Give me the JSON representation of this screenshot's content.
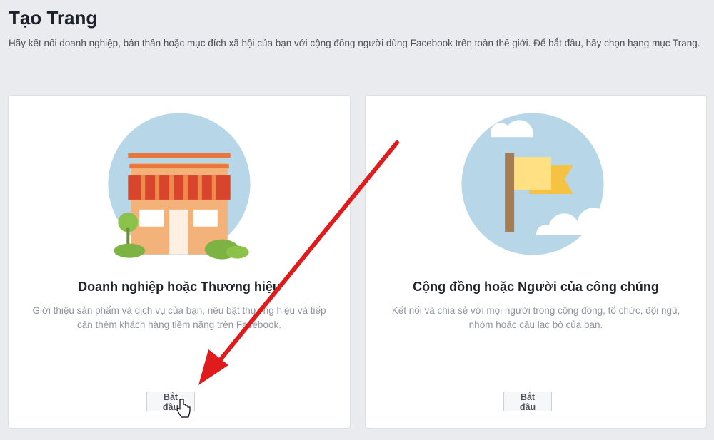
{
  "header": {
    "title": "Tạo Trang",
    "description": "Hãy kết nối doanh nghiệp, bản thân hoặc mục đích xã hội của bạn với cộng đồng người dùng Facebook trên toàn thế giới. Để bắt đầu, hãy chọn hạng mục Trang."
  },
  "cards": [
    {
      "title": "Doanh nghiệp hoặc Thương hiệu",
      "description": "Giới thiệu sản phẩm và dịch vụ của bạn, nêu bật thương hiệu và tiếp cận thêm khách hàng tiềm năng trên Facebook.",
      "button": "Bắt đầu",
      "icon": "storefront-icon"
    },
    {
      "title": "Cộng đồng hoặc Người của công chúng",
      "description": "Kết nối và chia sẻ với mọi người trong cộng đồng, tổ chức, đội ngũ, nhóm hoặc câu lạc bộ của bạn.",
      "button": "Bắt đầu",
      "icon": "flag-icon"
    }
  ],
  "colors": {
    "background": "#e9ebee",
    "circle": "#b7d7e8",
    "annotation_arrow": "#e01b1b"
  }
}
